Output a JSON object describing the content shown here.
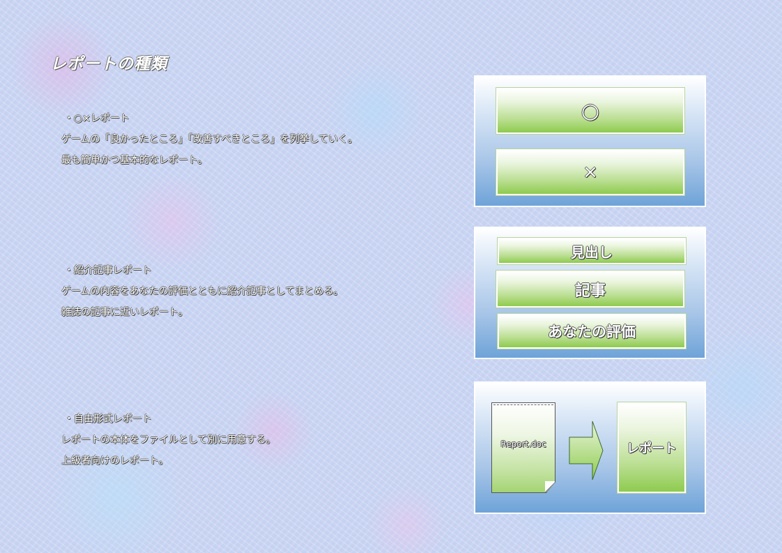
{
  "page": {
    "title": "レポートの種類"
  },
  "sections": [
    {
      "heading": "・○×レポート",
      "lines": [
        "ゲームの「良かったところ」「改善すべきところ」を列挙していく。",
        "最も簡単かつ基本的なレポート。"
      ]
    },
    {
      "heading": "・紹介記事レポート",
      "lines": [
        "ゲームの内容をあなたの評価とともに紹介記事としてまとめる。",
        "雑誌の記事に近いレポート。"
      ]
    },
    {
      "heading": "・自由形式レポート",
      "lines": [
        "レポートの本体をファイルとして別に用意する。",
        "上級者向けのレポート。"
      ]
    }
  ],
  "panels": {
    "maru_batsu": {
      "maru": "○",
      "batsu": "×"
    },
    "article": {
      "midashi": "見出し",
      "kiji": "記事",
      "hyouka": "あなたの評価"
    },
    "free": {
      "file_name": "Report.doc",
      "report": "レポート"
    }
  },
  "colors": {
    "panel_gradient_bottom": "#6ea3d8",
    "box_gradient_bottom": "#8ecb4f",
    "text_outline": "#444444"
  }
}
